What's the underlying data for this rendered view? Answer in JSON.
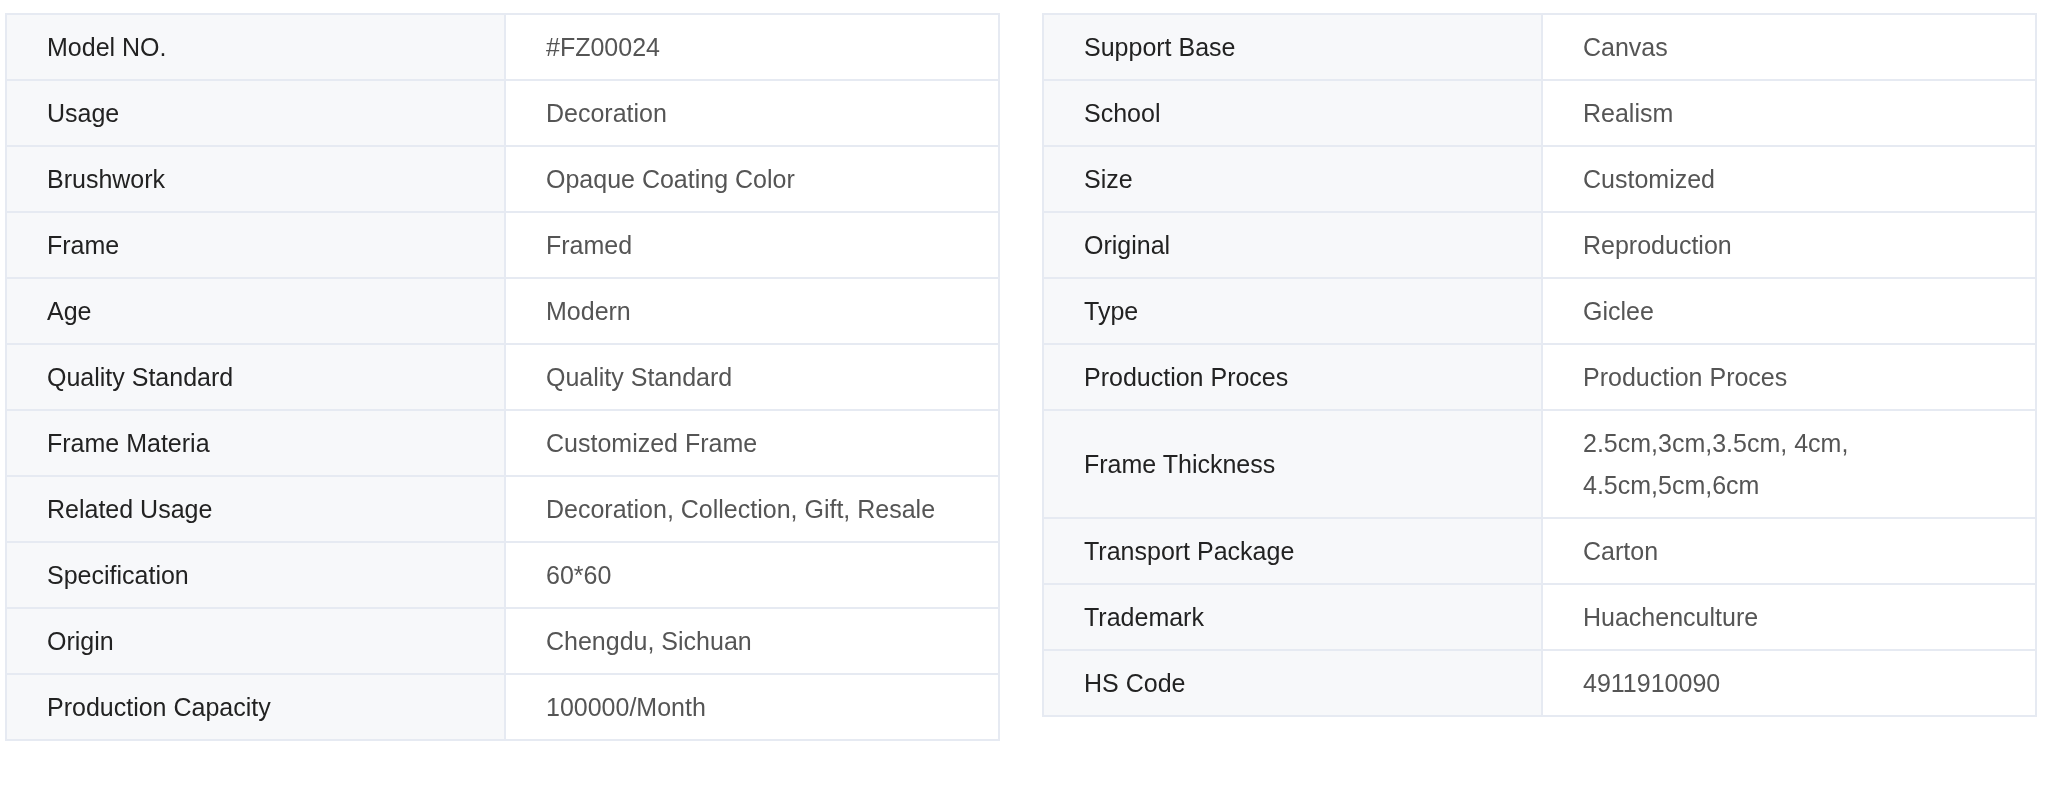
{
  "tables": [
    {
      "rows": [
        {
          "label": "Model NO.",
          "value": "#FZ00024"
        },
        {
          "label": "Usage",
          "value": "Decoration"
        },
        {
          "label": "Brushwork",
          "value": "Opaque Coating Color"
        },
        {
          "label": "Frame",
          "value": "Framed"
        },
        {
          "label": "Age",
          "value": "Modern"
        },
        {
          "label": "Quality Standard",
          "value": "Quality Standard"
        },
        {
          "label": "Frame Materia",
          "value": "Customized Frame"
        },
        {
          "label": "Related Usage",
          "value": "Decoration, Collection, Gift, Resale"
        },
        {
          "label": "Specification",
          "value": "60*60"
        },
        {
          "label": "Origin",
          "value": "Chengdu, Sichuan"
        },
        {
          "label": "Production Capacity",
          "value": "100000/Month"
        }
      ]
    },
    {
      "rows": [
        {
          "label": "Support Base",
          "value": "Canvas"
        },
        {
          "label": "School",
          "value": "Realism"
        },
        {
          "label": "Size",
          "value": "Customized"
        },
        {
          "label": "Original",
          "value": "Reproduction"
        },
        {
          "label": "Type",
          "value": "Giclee"
        },
        {
          "label": "Production Proces",
          "value": "Production Proces"
        },
        {
          "label": "Frame Thickness",
          "value": "2.5cm,3cm,3.5cm, 4cm, 4.5cm,5cm,6cm"
        },
        {
          "label": "Transport Package",
          "value": "Carton"
        },
        {
          "label": "Trademark",
          "value": "Huachenculture"
        },
        {
          "label": "HS Code",
          "value": "4911910090"
        }
      ]
    }
  ]
}
